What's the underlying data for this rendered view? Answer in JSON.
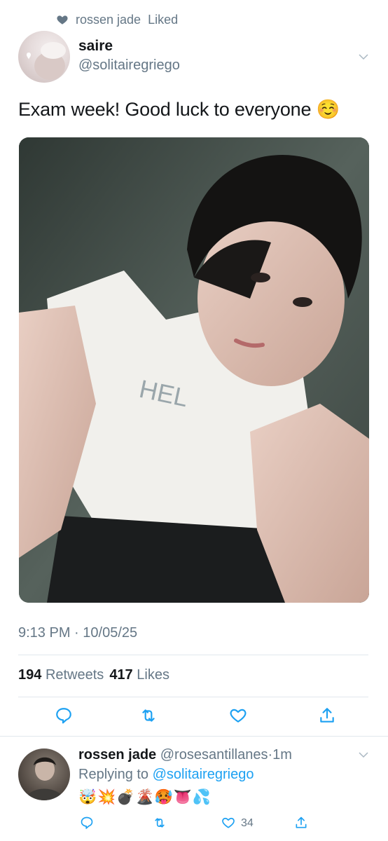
{
  "social_context": {
    "actor": "rossen jade",
    "action": "Liked"
  },
  "tweet": {
    "display_name": "saire",
    "handle": "@solitairegriego",
    "text": "Exam week! Good luck to everyone ☺️",
    "time": "9:13 PM",
    "date": "10/05/25",
    "retweets_count": "194",
    "retweets_label": "Retweets",
    "likes_count": "417",
    "likes_label": "Likes"
  },
  "reply": {
    "display_name": "rossen jade",
    "handle": "@rosesantillanes",
    "age": "1m",
    "replying_prefix": "Replying to",
    "replying_to": "@solitairegriego",
    "emojis": "🤯💥💣🌋🥵👅💦",
    "likes_count": "34"
  },
  "colors": {
    "accent": "#1da1f2",
    "muted": "#657786",
    "icon": "#1da1f2"
  },
  "icons": {
    "context": "heart-icon",
    "caret": "chevron-down-icon",
    "actions": [
      "reply-icon",
      "retweet-icon",
      "like-icon",
      "share-icon"
    ]
  }
}
